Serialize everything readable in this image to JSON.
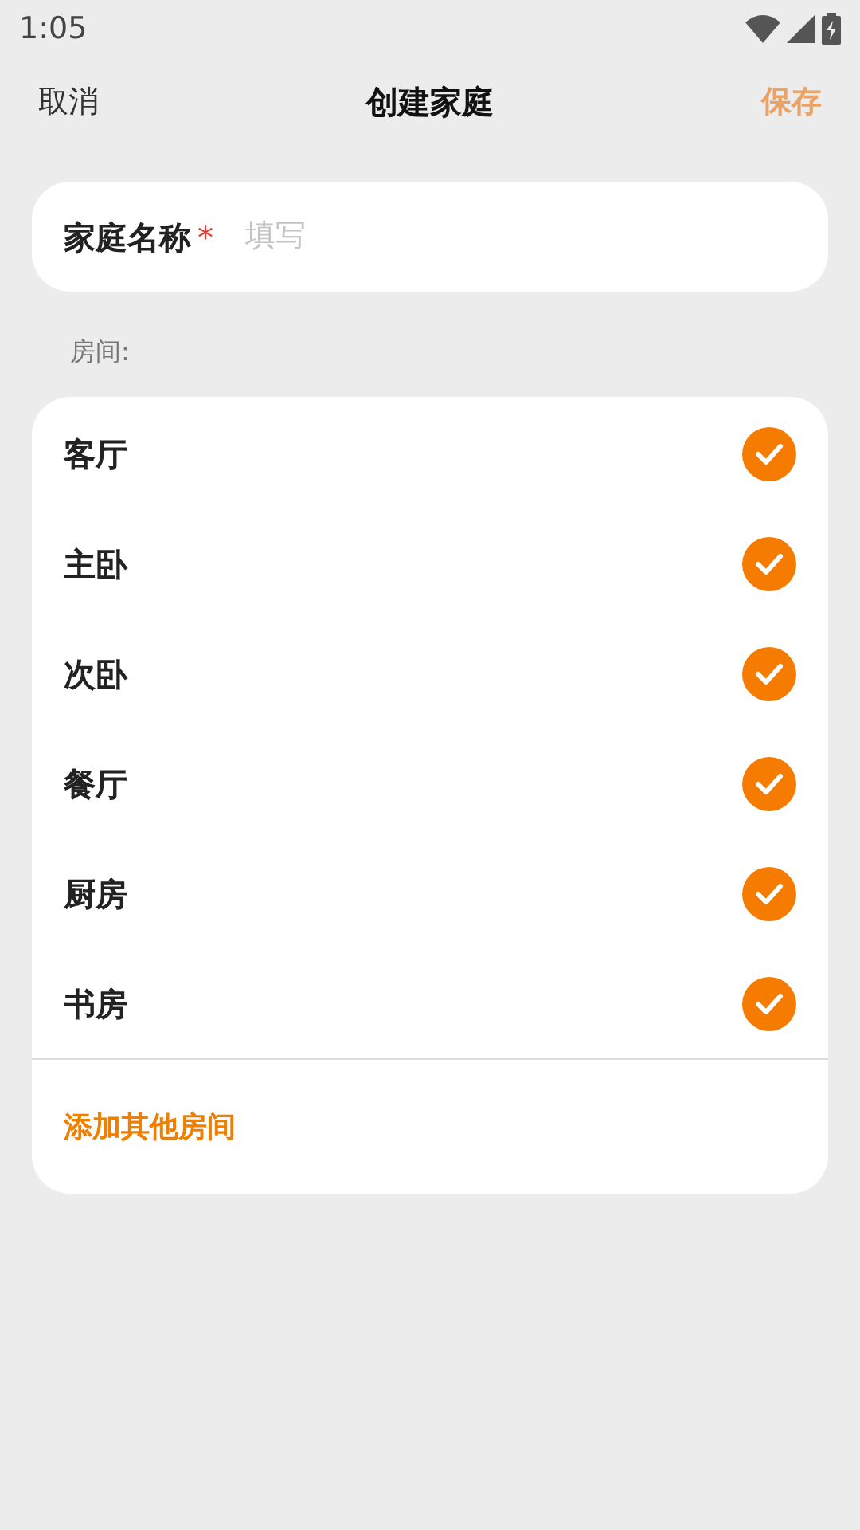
{
  "status_bar": {
    "time": "1:05"
  },
  "header": {
    "cancel": "取消",
    "title": "创建家庭",
    "save": {
      "label": "保存",
      "disabled": true
    }
  },
  "name_field": {
    "label": "家庭名称",
    "required_mark": "*",
    "placeholder": "填写"
  },
  "rooms_label": "房间:",
  "rooms": [
    {
      "name": "客厅",
      "checked": true
    },
    {
      "name": "主卧",
      "checked": true
    },
    {
      "name": "次卧",
      "checked": true
    },
    {
      "name": "餐厅",
      "checked": true
    },
    {
      "name": "厨房",
      "checked": true
    },
    {
      "name": "书房",
      "checked": true
    }
  ],
  "add_room": "添加其他房间"
}
